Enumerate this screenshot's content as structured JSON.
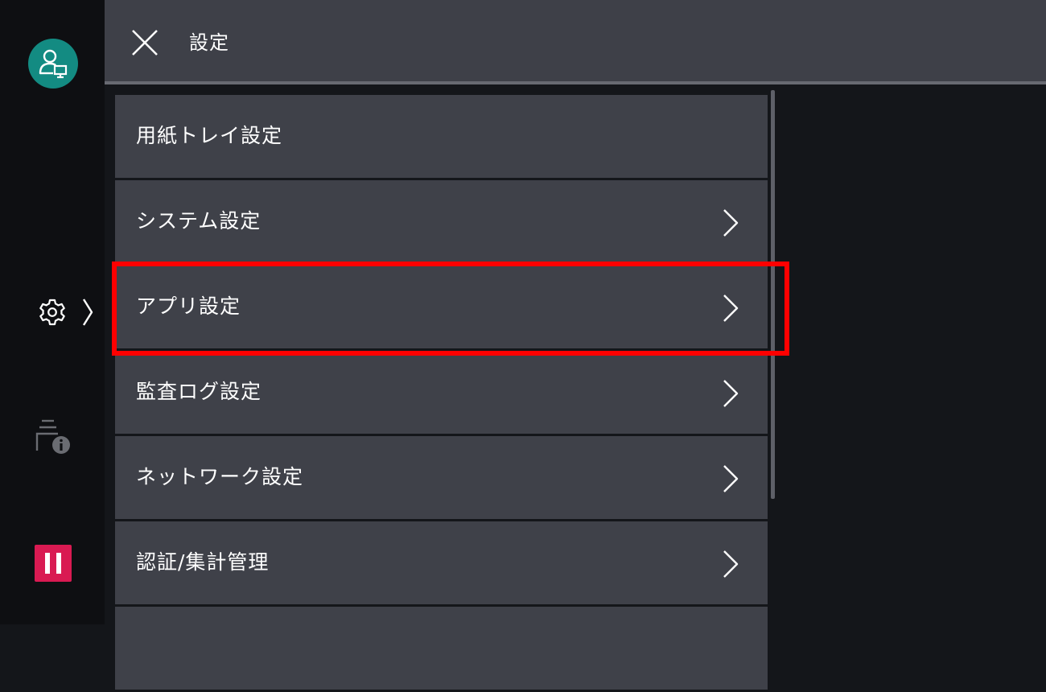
{
  "header": {
    "title": "設定",
    "close_icon": "close-icon"
  },
  "sidebar": {
    "avatar_icon": "user-device-icon",
    "settings_icon": "gear-icon",
    "tray_info_icon": "tray-info-icon",
    "pause_icon": "pause-icon"
  },
  "menu": {
    "items": [
      {
        "label": "用紙トレイ設定",
        "has_chevron": false
      },
      {
        "label": "システム設定",
        "has_chevron": true
      },
      {
        "label": "アプリ設定",
        "has_chevron": true,
        "highlighted": true
      },
      {
        "label": "監査ログ設定",
        "has_chevron": true
      },
      {
        "label": "ネットワーク設定",
        "has_chevron": true
      },
      {
        "label": "認証/集計管理",
        "has_chevron": true
      },
      {
        "label": "",
        "has_chevron": false
      }
    ]
  },
  "colors": {
    "header_bg": "#3e4048",
    "item_bg": "#3f4149",
    "avatar_bg": "#138b82",
    "pause_bg": "#d91a52",
    "highlight_border": "#ff0000"
  }
}
